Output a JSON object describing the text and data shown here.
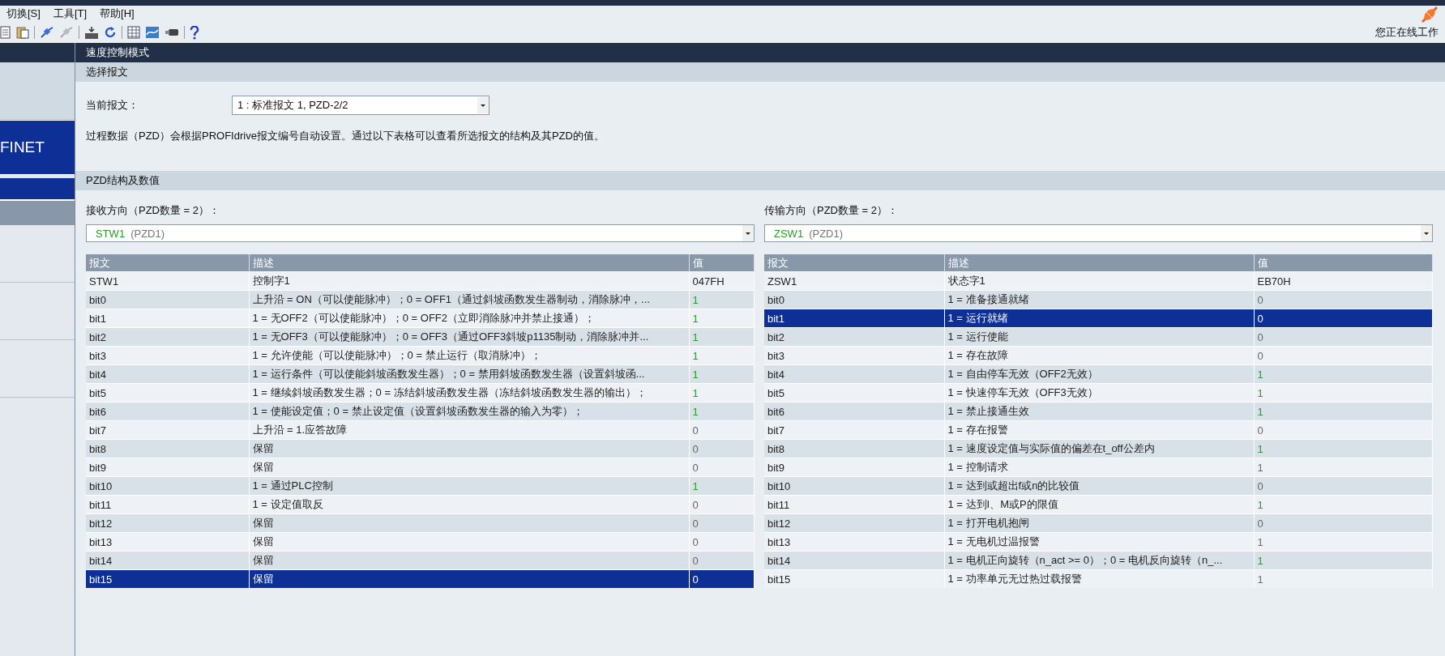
{
  "menu": [
    "切换[S]",
    "工具[T]",
    "帮助[H]"
  ],
  "status": {
    "label": "您正在线工作"
  },
  "header": {
    "title": "速度控制模式"
  },
  "sidebar": {
    "items": [
      {
        "label": "FINET",
        "selected": true
      }
    ]
  },
  "telegram_section": {
    "title": "选择报文",
    "field_label": "当前报文：",
    "dropdown_value": "1 : 标准报文 1, PZD-2/2",
    "note": "过程数据（PZD）会根据PROFIdrive报文编号自动设置。通过以下表格可以查看所选报文的结构及其PZD的值。"
  },
  "pzd_section": {
    "title": "PZD结构及数值"
  },
  "panels": [
    {
      "label": "接收方向（PZD数量 = 2）：",
      "dropdown_code": "STW1",
      "dropdown_suffix": "(PZD1)",
      "columns": [
        "报文",
        "描述",
        "值"
      ],
      "rows": [
        {
          "kind": "word",
          "message": "STW1",
          "description": "控制字1",
          "value": "047FH",
          "selected": false
        },
        {
          "kind": "bit",
          "message": "bit0",
          "description": "上升沿 = ON（可以使能脉冲）；0 = OFF1（通过斜坡函数发生器制动，消除脉冲，...",
          "value": "1",
          "active": true,
          "selected": false
        },
        {
          "kind": "bit",
          "message": "bit1",
          "description": "1 = 无OFF2（可以使能脉冲）；0 = OFF2（立即消除脉冲并禁止接通）；",
          "value": "1",
          "active": true,
          "selected": false
        },
        {
          "kind": "bit",
          "message": "bit2",
          "description": "1 = 无OFF3（可以使能脉冲）；0 = OFF3（通过OFF3斜坡p1135制动，消除脉冲并...",
          "value": "1",
          "active": true,
          "selected": false
        },
        {
          "kind": "bit",
          "message": "bit3",
          "description": "1 = 允许使能（可以使能脉冲）；0 = 禁止运行（取消脉冲）；",
          "value": "1",
          "active": true,
          "selected": false
        },
        {
          "kind": "bit",
          "message": "bit4",
          "description": "1 = 运行条件（可以使能斜坡函数发生器）；0 = 禁用斜坡函数发生器（设置斜坡函...",
          "value": "1",
          "active": true,
          "selected": false
        },
        {
          "kind": "bit",
          "message": "bit5",
          "description": "1 = 继续斜坡函数发生器；0 = 冻结斜坡函数发生器（冻结斜坡函数发生器的输出）；",
          "value": "1",
          "active": true,
          "selected": false
        },
        {
          "kind": "bit",
          "message": "bit6",
          "description": "1 = 使能设定值；0 = 禁止设定值（设置斜坡函数发生器的输入为零）；",
          "value": "1",
          "active": true,
          "selected": false
        },
        {
          "kind": "bit",
          "message": "bit7",
          "description": "上升沿 = 1.应答故障",
          "value": "0",
          "active": false,
          "selected": false
        },
        {
          "kind": "bit",
          "message": "bit8",
          "description": "保留",
          "value": "0",
          "active": false,
          "selected": false
        },
        {
          "kind": "bit",
          "message": "bit9",
          "description": "保留",
          "value": "0",
          "active": false,
          "selected": false
        },
        {
          "kind": "bit",
          "message": "bit10",
          "description": "1 = 通过PLC控制",
          "value": "1",
          "active": true,
          "selected": false
        },
        {
          "kind": "bit",
          "message": "bit11",
          "description": "1 = 设定值取反",
          "value": "0",
          "active": false,
          "selected": false
        },
        {
          "kind": "bit",
          "message": "bit12",
          "description": "保留",
          "value": "0",
          "active": false,
          "selected": false
        },
        {
          "kind": "bit",
          "message": "bit13",
          "description": "保留",
          "value": "0",
          "active": false,
          "selected": false
        },
        {
          "kind": "bit",
          "message": "bit14",
          "description": "保留",
          "value": "0",
          "active": false,
          "selected": false
        },
        {
          "kind": "bit",
          "message": "bit15",
          "description": "保留",
          "value": "0",
          "active": false,
          "selected": true
        }
      ]
    },
    {
      "label": "传输方向（PZD数量 = 2）：",
      "dropdown_code": "ZSW1",
      "dropdown_suffix": "(PZD1)",
      "columns": [
        "报文",
        "描述",
        "值"
      ],
      "rows": [
        {
          "kind": "word",
          "message": "ZSW1",
          "description": "状态字1",
          "value": "EB70H",
          "selected": false
        },
        {
          "kind": "bit",
          "message": "bit0",
          "description": "1 = 准备接通就绪",
          "value": "0",
          "active": false,
          "selected": false
        },
        {
          "kind": "bit",
          "message": "bit1",
          "description": "1 = 运行就绪",
          "value": "0",
          "active": false,
          "selected": true
        },
        {
          "kind": "bit",
          "message": "bit2",
          "description": "1 = 运行使能",
          "value": "0",
          "active": false,
          "selected": false
        },
        {
          "kind": "bit",
          "message": "bit3",
          "description": "1 = 存在故障",
          "value": "0",
          "active": false,
          "selected": false
        },
        {
          "kind": "bit",
          "message": "bit4",
          "description": "1 = 自由停车无效（OFF2无效）",
          "value": "1",
          "active": true,
          "selected": false
        },
        {
          "kind": "bit",
          "message": "bit5",
          "description": "1 = 快速停车无效（OFF3无效）",
          "value": "1",
          "active": true,
          "selected": false
        },
        {
          "kind": "bit",
          "message": "bit6",
          "description": "1 = 禁止接通生效",
          "value": "1",
          "active": true,
          "selected": false
        },
        {
          "kind": "bit",
          "message": "bit7",
          "description": "1 = 存在报警",
          "value": "0",
          "active": false,
          "selected": false
        },
        {
          "kind": "bit",
          "message": "bit8",
          "description": "1 = 速度设定值与实际值的偏差在t_off公差内",
          "value": "1",
          "active": true,
          "selected": false
        },
        {
          "kind": "bit",
          "message": "bit9",
          "description": "1 = 控制请求",
          "value": "1",
          "active": true,
          "selected": false
        },
        {
          "kind": "bit",
          "message": "bit10",
          "description": "1 = 达到或超出f或n的比较值",
          "value": "0",
          "active": false,
          "selected": false
        },
        {
          "kind": "bit",
          "message": "bit11",
          "description": "1 = 达到I、M或P的限值",
          "value": "1",
          "active": true,
          "selected": false
        },
        {
          "kind": "bit",
          "message": "bit12",
          "description": "1 = 打开电机抱闸",
          "value": "0",
          "active": false,
          "selected": false
        },
        {
          "kind": "bit",
          "message": "bit13",
          "description": "1 = 无电机过温报警",
          "value": "1",
          "active": true,
          "selected": false
        },
        {
          "kind": "bit",
          "message": "bit14",
          "description": "1 = 电机正向旋转（n_act >= 0）；0 = 电机反向旋转（n_...",
          "value": "1",
          "active": true,
          "selected": false
        },
        {
          "kind": "bit",
          "message": "bit15",
          "description": "1 = 功率单元无过热过载报警",
          "value": "1",
          "active": true,
          "selected": false
        }
      ]
    }
  ]
}
